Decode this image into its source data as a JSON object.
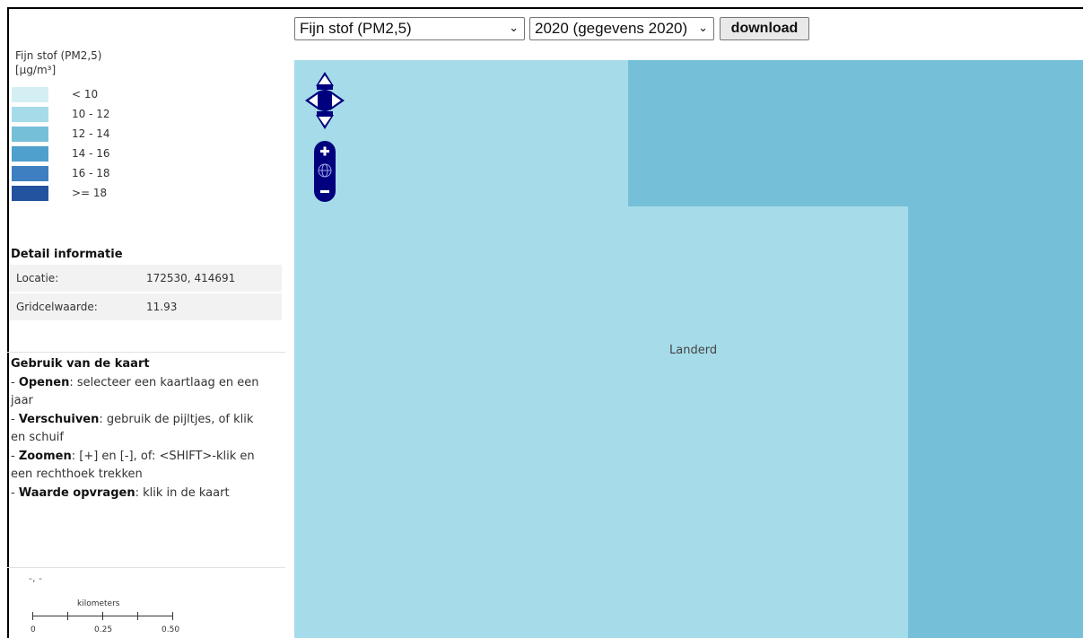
{
  "controls": {
    "layer_select": "Fijn stof (PM2,5)",
    "year_select": "2020 (gegevens 2020)",
    "download_label": "download"
  },
  "legend": {
    "title": "Fijn stof (PM2,5)\n[µg/m³]",
    "items": [
      {
        "label": "< 10",
        "color": "#d4eff4"
      },
      {
        "label": "10 - 12",
        "color": "#a6dce9"
      },
      {
        "label": "12 - 14",
        "color": "#76bfd8"
      },
      {
        "label": "14 - 16",
        "color": "#4fa0cc"
      },
      {
        "label": "16 - 18",
        "color": "#3d7fc0"
      },
      {
        "label": ">= 18",
        "color": "#23539f"
      }
    ]
  },
  "detail": {
    "heading": "Detail informatie",
    "rows": [
      {
        "key": "Locatie:",
        "value": "172530, 414691"
      },
      {
        "key": "Gridcelwaarde:",
        "value": "11.93"
      }
    ]
  },
  "help": {
    "heading": "Gebruik van de kaart",
    "lines": [
      {
        "term": "Openen",
        "text": ": selecteer een kaartlaag en een jaar"
      },
      {
        "term": "Verschuiven",
        "text": ": gebruik de pijltjes, of klik en schuif"
      },
      {
        "term": "Zoomen",
        "text": ": [+] en [-], of: <SHIFT>-klik en een rechthoek trekken"
      },
      {
        "term": "Waarde opvragen",
        "text": ": klik in de kaart"
      }
    ]
  },
  "coords_readout": "-, -",
  "scalebar": {
    "unit": "kilometers",
    "ticks": [
      "0",
      "0.25",
      "0.50"
    ]
  },
  "map": {
    "place_label": "Landerd",
    "cells": [
      {
        "value_class": "10 - 12",
        "color": "#a6dce9"
      },
      {
        "value_class": "12 - 14",
        "color": "#76bfd8"
      }
    ]
  },
  "icons": [
    "pan-arrows-icon",
    "zoom-in-icon",
    "zoom-world-icon",
    "zoom-out-icon",
    "chevron-down-icon"
  ],
  "accent_color": "#00007f"
}
